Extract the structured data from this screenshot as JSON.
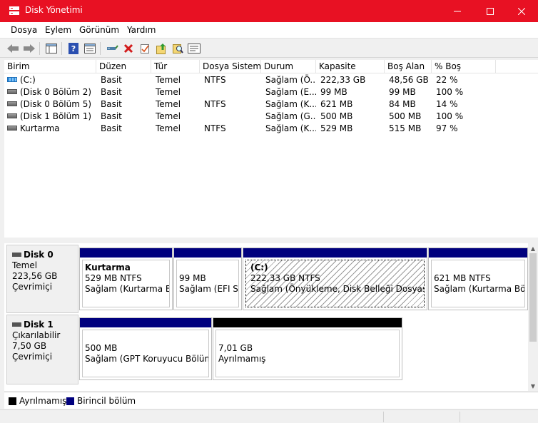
{
  "window": {
    "title": "Disk Yönetimi",
    "title_bar_color": "#e81123"
  },
  "menu": [
    "Dosya",
    "Eylem",
    "Görünüm",
    "Yardım"
  ],
  "toolbar": {
    "icons": [
      "back-arrow-icon",
      "forward-arrow-icon",
      "console-tree-icon",
      "help-icon",
      "properties-icon",
      "connect-drive-icon",
      "delete-icon",
      "check-icon",
      "export-icon",
      "search-icon",
      "rescan-icon"
    ]
  },
  "list": {
    "columns": [
      "Birim",
      "Düzen",
      "Tür",
      "Dosya Sistemi",
      "Durum",
      "Kapasite",
      "Boş Alan",
      "% Boş"
    ],
    "rows": [
      {
        "birim": "(C:)",
        "duzen": "Basit",
        "tur": "Temel",
        "fs": "NTFS",
        "durum": "Sağlam (Ö...",
        "kapasite": "222,33 GB",
        "bos": "48,56 GB",
        "yuzde": "22 %"
      },
      {
        "birim": "(Disk 0 Bölüm 2)",
        "duzen": "Basit",
        "tur": "Temel",
        "fs": "",
        "durum": "Sağlam (E...",
        "kapasite": "99 MB",
        "bos": "99 MB",
        "yuzde": "100 %"
      },
      {
        "birim": "(Disk 0 Bölüm 5)",
        "duzen": "Basit",
        "tur": "Temel",
        "fs": "NTFS",
        "durum": "Sağlam (K...",
        "kapasite": "621 MB",
        "bos": "84 MB",
        "yuzde": "14 %"
      },
      {
        "birim": "(Disk 1 Bölüm 1)",
        "duzen": "Basit",
        "tur": "Temel",
        "fs": "",
        "durum": "Sağlam (G...",
        "kapasite": "500 MB",
        "bos": "500 MB",
        "yuzde": "100 %"
      },
      {
        "birim": "Kurtarma",
        "duzen": "Basit",
        "tur": "Temel",
        "fs": "NTFS",
        "durum": "Sağlam (K...",
        "kapasite": "529 MB",
        "bos": "515 MB",
        "yuzde": "97 %"
      }
    ]
  },
  "disks": [
    {
      "name": "Disk 0",
      "type": "Temel",
      "size": "223,56 GB",
      "status": "Çevrimiçi",
      "partitions": [
        {
          "title": "Kurtarma",
          "line1": "529 MB NTFS",
          "line2": "Sağlam (Kurtarma Böl"
        },
        {
          "title": "",
          "line1": "99 MB",
          "line2": "Sağlam (EFI Sist"
        },
        {
          "title": "(C:)",
          "line1": "222,33 GB NTFS",
          "line2": "Sağlam (Önyükleme, Disk Belleği Dosyası, Kilitl"
        },
        {
          "title": "",
          "line1": "621 MB NTFS",
          "line2": "Sağlam (Kurtarma Bölü"
        }
      ]
    },
    {
      "name": "Disk 1",
      "type": "Çıkarılabilir",
      "size": "7,50 GB",
      "status": "Çevrimiçi",
      "partitions": [
        {
          "title": "",
          "line1": "500 MB",
          "line2": "Sağlam (GPT Koruyucu Bölüm)"
        },
        {
          "title": "",
          "line1": "7,01 GB",
          "line2": "Ayrılmamış"
        }
      ]
    }
  ],
  "legend": [
    {
      "label": "Ayrılmamış",
      "color": "#000000"
    },
    {
      "label": "Birincil bölüm",
      "color": "#00007e"
    }
  ]
}
